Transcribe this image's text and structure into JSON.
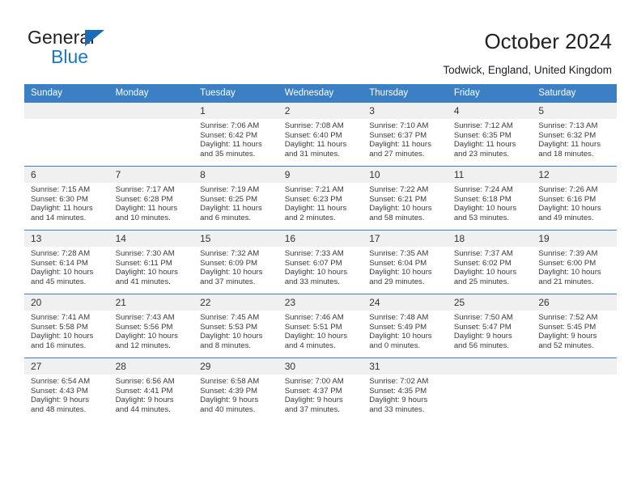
{
  "brand": {
    "name_top": "General",
    "name_bottom": "Blue",
    "triangle_color": "#1a6cb5",
    "blue_text_color": "#1b79c4"
  },
  "header": {
    "title": "October 2024",
    "subtitle": "Todwick, England, United Kingdom"
  },
  "theme": {
    "header_blue": "#3b7fc4",
    "daynum_band": "#f0f0f0",
    "row_rule": "#3b7fc4"
  },
  "weekday_headers": [
    "Sunday",
    "Monday",
    "Tuesday",
    "Wednesday",
    "Thursday",
    "Friday",
    "Saturday"
  ],
  "labels": {
    "sunrise_prefix": "Sunrise: ",
    "sunset_prefix": "Sunset: ",
    "daylight_prefix": "Daylight: "
  },
  "weeks": [
    [
      {
        "day": "",
        "sunrise": "",
        "sunset": "",
        "daylight": "",
        "empty": true
      },
      {
        "day": "",
        "sunrise": "",
        "sunset": "",
        "daylight": "",
        "empty": true
      },
      {
        "day": "1",
        "sunrise": "Sunrise: 7:06 AM",
        "sunset": "Sunset: 6:42 PM",
        "daylight": "Daylight: 11 hours and 35 minutes."
      },
      {
        "day": "2",
        "sunrise": "Sunrise: 7:08 AM",
        "sunset": "Sunset: 6:40 PM",
        "daylight": "Daylight: 11 hours and 31 minutes."
      },
      {
        "day": "3",
        "sunrise": "Sunrise: 7:10 AM",
        "sunset": "Sunset: 6:37 PM",
        "daylight": "Daylight: 11 hours and 27 minutes."
      },
      {
        "day": "4",
        "sunrise": "Sunrise: 7:12 AM",
        "sunset": "Sunset: 6:35 PM",
        "daylight": "Daylight: 11 hours and 23 minutes."
      },
      {
        "day": "5",
        "sunrise": "Sunrise: 7:13 AM",
        "sunset": "Sunset: 6:32 PM",
        "daylight": "Daylight: 11 hours and 18 minutes."
      }
    ],
    [
      {
        "day": "6",
        "sunrise": "Sunrise: 7:15 AM",
        "sunset": "Sunset: 6:30 PM",
        "daylight": "Daylight: 11 hours and 14 minutes."
      },
      {
        "day": "7",
        "sunrise": "Sunrise: 7:17 AM",
        "sunset": "Sunset: 6:28 PM",
        "daylight": "Daylight: 11 hours and 10 minutes."
      },
      {
        "day": "8",
        "sunrise": "Sunrise: 7:19 AM",
        "sunset": "Sunset: 6:25 PM",
        "daylight": "Daylight: 11 hours and 6 minutes."
      },
      {
        "day": "9",
        "sunrise": "Sunrise: 7:21 AM",
        "sunset": "Sunset: 6:23 PM",
        "daylight": "Daylight: 11 hours and 2 minutes."
      },
      {
        "day": "10",
        "sunrise": "Sunrise: 7:22 AM",
        "sunset": "Sunset: 6:21 PM",
        "daylight": "Daylight: 10 hours and 58 minutes."
      },
      {
        "day": "11",
        "sunrise": "Sunrise: 7:24 AM",
        "sunset": "Sunset: 6:18 PM",
        "daylight": "Daylight: 10 hours and 53 minutes."
      },
      {
        "day": "12",
        "sunrise": "Sunrise: 7:26 AM",
        "sunset": "Sunset: 6:16 PM",
        "daylight": "Daylight: 10 hours and 49 minutes."
      }
    ],
    [
      {
        "day": "13",
        "sunrise": "Sunrise: 7:28 AM",
        "sunset": "Sunset: 6:14 PM",
        "daylight": "Daylight: 10 hours and 45 minutes."
      },
      {
        "day": "14",
        "sunrise": "Sunrise: 7:30 AM",
        "sunset": "Sunset: 6:11 PM",
        "daylight": "Daylight: 10 hours and 41 minutes."
      },
      {
        "day": "15",
        "sunrise": "Sunrise: 7:32 AM",
        "sunset": "Sunset: 6:09 PM",
        "daylight": "Daylight: 10 hours and 37 minutes."
      },
      {
        "day": "16",
        "sunrise": "Sunrise: 7:33 AM",
        "sunset": "Sunset: 6:07 PM",
        "daylight": "Daylight: 10 hours and 33 minutes."
      },
      {
        "day": "17",
        "sunrise": "Sunrise: 7:35 AM",
        "sunset": "Sunset: 6:04 PM",
        "daylight": "Daylight: 10 hours and 29 minutes."
      },
      {
        "day": "18",
        "sunrise": "Sunrise: 7:37 AM",
        "sunset": "Sunset: 6:02 PM",
        "daylight": "Daylight: 10 hours and 25 minutes."
      },
      {
        "day": "19",
        "sunrise": "Sunrise: 7:39 AM",
        "sunset": "Sunset: 6:00 PM",
        "daylight": "Daylight: 10 hours and 21 minutes."
      }
    ],
    [
      {
        "day": "20",
        "sunrise": "Sunrise: 7:41 AM",
        "sunset": "Sunset: 5:58 PM",
        "daylight": "Daylight: 10 hours and 16 minutes."
      },
      {
        "day": "21",
        "sunrise": "Sunrise: 7:43 AM",
        "sunset": "Sunset: 5:56 PM",
        "daylight": "Daylight: 10 hours and 12 minutes."
      },
      {
        "day": "22",
        "sunrise": "Sunrise: 7:45 AM",
        "sunset": "Sunset: 5:53 PM",
        "daylight": "Daylight: 10 hours and 8 minutes."
      },
      {
        "day": "23",
        "sunrise": "Sunrise: 7:46 AM",
        "sunset": "Sunset: 5:51 PM",
        "daylight": "Daylight: 10 hours and 4 minutes."
      },
      {
        "day": "24",
        "sunrise": "Sunrise: 7:48 AM",
        "sunset": "Sunset: 5:49 PM",
        "daylight": "Daylight: 10 hours and 0 minutes."
      },
      {
        "day": "25",
        "sunrise": "Sunrise: 7:50 AM",
        "sunset": "Sunset: 5:47 PM",
        "daylight": "Daylight: 9 hours and 56 minutes."
      },
      {
        "day": "26",
        "sunrise": "Sunrise: 7:52 AM",
        "sunset": "Sunset: 5:45 PM",
        "daylight": "Daylight: 9 hours and 52 minutes."
      }
    ],
    [
      {
        "day": "27",
        "sunrise": "Sunrise: 6:54 AM",
        "sunset": "Sunset: 4:43 PM",
        "daylight": "Daylight: 9 hours and 48 minutes."
      },
      {
        "day": "28",
        "sunrise": "Sunrise: 6:56 AM",
        "sunset": "Sunset: 4:41 PM",
        "daylight": "Daylight: 9 hours and 44 minutes."
      },
      {
        "day": "29",
        "sunrise": "Sunrise: 6:58 AM",
        "sunset": "Sunset: 4:39 PM",
        "daylight": "Daylight: 9 hours and 40 minutes."
      },
      {
        "day": "30",
        "sunrise": "Sunrise: 7:00 AM",
        "sunset": "Sunset: 4:37 PM",
        "daylight": "Daylight: 9 hours and 37 minutes."
      },
      {
        "day": "31",
        "sunrise": "Sunrise: 7:02 AM",
        "sunset": "Sunset: 4:35 PM",
        "daylight": "Daylight: 9 hours and 33 minutes."
      },
      {
        "day": "",
        "sunrise": "",
        "sunset": "",
        "daylight": "",
        "empty": true
      },
      {
        "day": "",
        "sunrise": "",
        "sunset": "",
        "daylight": "",
        "empty": true
      }
    ]
  ]
}
